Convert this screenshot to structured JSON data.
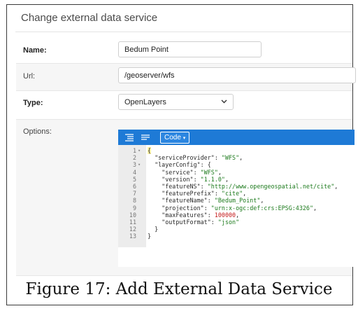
{
  "dialog": {
    "title": "Change external data service"
  },
  "form": {
    "name_label": "Name:",
    "name_value": "Bedum Point",
    "url_label": "Url:",
    "url_value": "/geoserver/wfs",
    "type_label": "Type:",
    "type_value": "OpenLayers",
    "options_label": "Options:"
  },
  "editor": {
    "mode_button": "Code",
    "icons": [
      "format-icon",
      "compact-icon",
      "caret-down-icon",
      "fold-arrow-icon"
    ],
    "lines": [
      {
        "n": "1",
        "fold": "▾",
        "text": "{"
      },
      {
        "n": "2",
        "fold": "",
        "text": "  \"serviceProvider\": \"WFS\","
      },
      {
        "n": "3",
        "fold": "▾",
        "text": "  \"layerConfig\": {"
      },
      {
        "n": "4",
        "fold": "",
        "text": "    \"service\": \"WFS\","
      },
      {
        "n": "5",
        "fold": "",
        "text": "    \"version\": \"1.1.0\","
      },
      {
        "n": "6",
        "fold": "",
        "text": "    \"featureNS\": \"http://www.opengeospatial.net/cite\","
      },
      {
        "n": "7",
        "fold": "",
        "text": "    \"featurePrefix\": \"cite\","
      },
      {
        "n": "8",
        "fold": "",
        "text": "    \"featureName\": \"Bedum_Point\","
      },
      {
        "n": "9",
        "fold": "",
        "text": "    \"projection\": \"urn:x-ogc:def:crs:EPSG:4326\","
      },
      {
        "n": "10",
        "fold": "",
        "text": "    \"maxFeatures\": 100000,"
      },
      {
        "n": "11",
        "fold": "",
        "text": "    \"outputFormat\": \"json\""
      },
      {
        "n": "12",
        "fold": "",
        "text": "  }"
      },
      {
        "n": "13",
        "fold": "",
        "text": "}"
      }
    ]
  },
  "caption": "Figure 17: Add External Data Service"
}
